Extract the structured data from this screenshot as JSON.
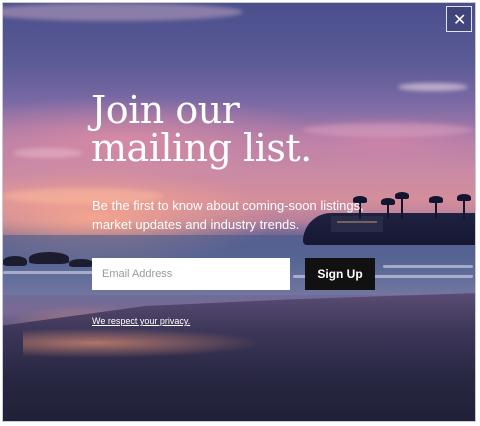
{
  "modal": {
    "close_label": "✕",
    "heading_lines": [
      "Join our",
      "mailing list."
    ],
    "subtext_lines": [
      "Be the first to know about coming-soon listings,",
      "market updates and industry trends."
    ],
    "email_placeholder": "Email Address",
    "email_value": "",
    "signup_label": "Sign Up",
    "privacy_label": "We respect your privacy.",
    "background_image": "sunset-beach-photo"
  },
  "colors": {
    "button_bg": "#111111",
    "button_text": "#ffffff",
    "text": "#ffffff",
    "input_bg": "#ffffff"
  }
}
